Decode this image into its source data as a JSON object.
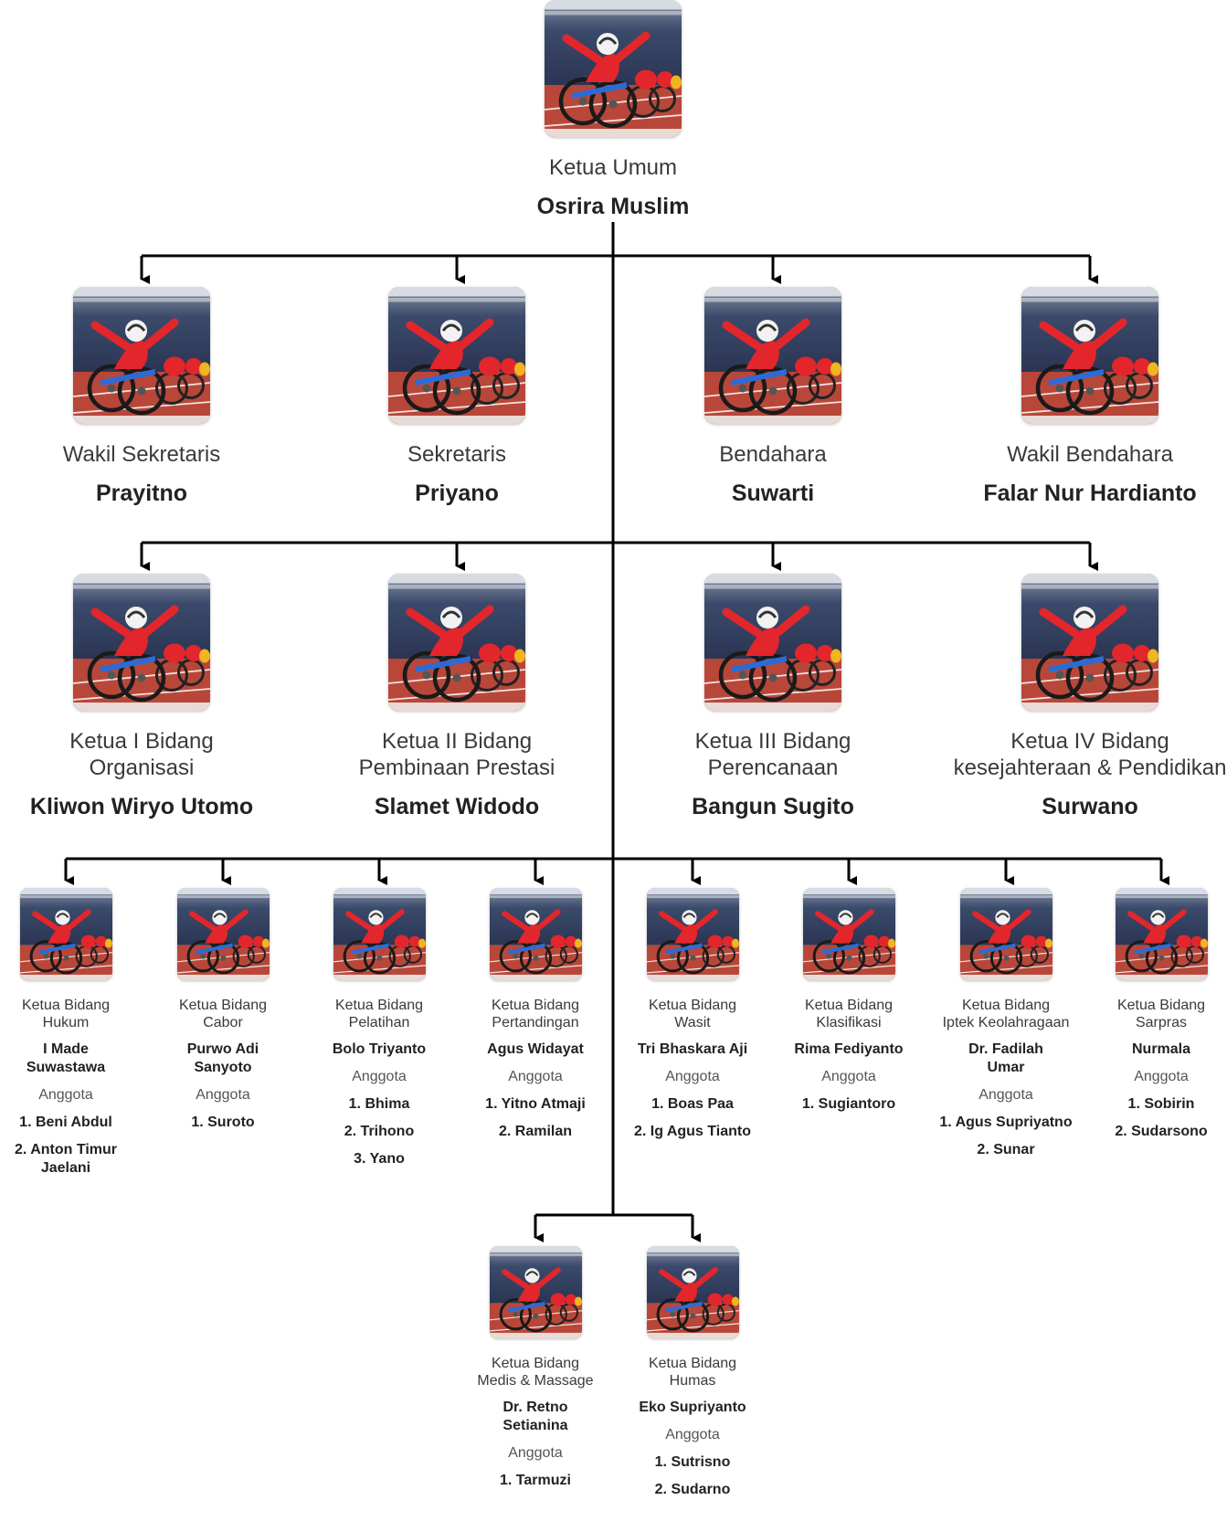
{
  "colors": {
    "line": "#000000",
    "accent_red": "#e3262b",
    "track": "#b8473a",
    "stand": "#3b4a6b"
  },
  "photo_icon": "wheelchair-racer-photo",
  "top": {
    "role": "Ketua Umum",
    "name": "Osrira Muslim"
  },
  "row1": [
    {
      "role": "Wakil Sekretaris",
      "name": "Prayitno"
    },
    {
      "role": "Sekretaris",
      "name": "Priyano"
    },
    {
      "role": "Bendahara",
      "name": "Suwarti"
    },
    {
      "role": "Wakil Bendahara",
      "name": "Falar Nur Hardianto"
    }
  ],
  "row2": [
    {
      "role_line1": "Ketua I Bidang",
      "role_line2": "Organisasi",
      "name": "Kliwon Wiryo Utomo"
    },
    {
      "role_line1": "Ketua II Bidang",
      "role_line2": "Pembinaan Prestasi",
      "name": "Slamet Widodo"
    },
    {
      "role_line1": "Ketua III Bidang",
      "role_line2": "Perencanaan",
      "name": "Bangun Sugito"
    },
    {
      "role_line1": "Ketua IV Bidang",
      "role_line2": "kesejahteraan & Pendidikan",
      "name": "Surwano"
    }
  ],
  "row3": [
    {
      "role_line1": "Ketua Bidang",
      "role_line2": "Hukum",
      "name_line1": "I Made",
      "name_line2": "Suwastawa",
      "members_label": "Anggota",
      "members": [
        {
          "line1": "1. Beni Abdul",
          "line2": ""
        },
        {
          "line1": "2. Anton Timur",
          "line2": "Jaelani"
        }
      ]
    },
    {
      "role_line1": "Ketua Bidang",
      "role_line2": "Cabor",
      "name_line1": "Purwo Adi",
      "name_line2": "Sanyoto",
      "members_label": "Anggota",
      "members": [
        {
          "line1": "1. Suroto",
          "line2": ""
        }
      ]
    },
    {
      "role_line1": "Ketua Bidang",
      "role_line2": "Pelatihan",
      "name_line1": "Bolo Triyanto",
      "name_line2": "",
      "members_label": "Anggota",
      "members": [
        {
          "line1": "1. Bhima",
          "line2": ""
        },
        {
          "line1": "2. Trihono",
          "line2": ""
        },
        {
          "line1": "3. Yano",
          "line2": ""
        }
      ]
    },
    {
      "role_line1": "Ketua Bidang",
      "role_line2": "Pertandingan",
      "name_line1": "Agus Widayat",
      "name_line2": "",
      "members_label": "Anggota",
      "members": [
        {
          "line1": "1. Yitno Atmaji",
          "line2": ""
        },
        {
          "line1": "2. Ramilan",
          "line2": ""
        }
      ]
    },
    {
      "role_line1": "Ketua Bidang",
      "role_line2": "Wasit",
      "name_line1": "Tri Bhaskara Aji",
      "name_line2": "",
      "members_label": "Anggota",
      "members": [
        {
          "line1": "1. Boas Paa",
          "line2": ""
        },
        {
          "line1": "2. Ig Agus Tianto",
          "line2": ""
        }
      ]
    },
    {
      "role_line1": "Ketua Bidang",
      "role_line2": "Klasifikasi",
      "name_line1": "Rima Fediyanto",
      "name_line2": "",
      "members_label": "Anggota",
      "members": [
        {
          "line1": "1. Sugiantoro",
          "line2": ""
        }
      ]
    },
    {
      "role_line1": "Ketua Bidang",
      "role_line2": "Iptek Keolahragaan",
      "name_line1": "Dr. Fadilah",
      "name_line2": "Umar",
      "members_label": "Anggota",
      "members": [
        {
          "line1": "1. Agus Supriyatno",
          "line2": ""
        },
        {
          "line1": "2. Sunar",
          "line2": ""
        }
      ]
    },
    {
      "role_line1": "Ketua Bidang",
      "role_line2": "Sarpras",
      "name_line1": "Nurmala",
      "name_line2": "",
      "members_label": "Anggota",
      "members": [
        {
          "line1": "1. Sobirin",
          "line2": ""
        },
        {
          "line1": "2. Sudarsono",
          "line2": ""
        }
      ]
    }
  ],
  "row4": [
    {
      "role_line1": "Ketua Bidang",
      "role_line2": "Medis & Massage",
      "name_line1": "Dr. Retno",
      "name_line2": "Setianina",
      "members_label": "Anggota",
      "members": [
        {
          "line1": "1. Tarmuzi",
          "line2": ""
        }
      ]
    },
    {
      "role_line1": "Ketua Bidang",
      "role_line2": "Humas",
      "name_line1": "Eko Supriyanto",
      "name_line2": "",
      "members_label": "Anggota",
      "members": [
        {
          "line1": "1. Sutrisno",
          "line2": ""
        },
        {
          "line1": "2. Sudarno",
          "line2": ""
        }
      ]
    }
  ]
}
